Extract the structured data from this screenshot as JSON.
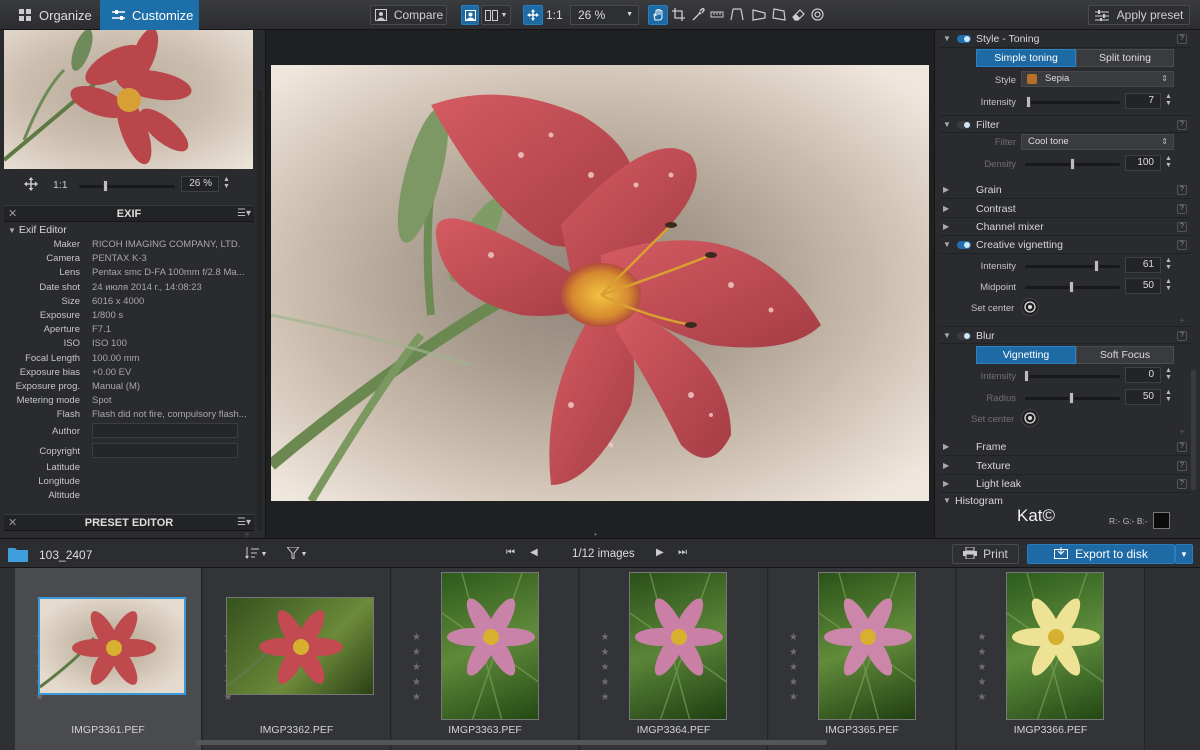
{
  "toolbar": {
    "organize_label": "Organize",
    "customize_label": "Customize",
    "compare_label": "Compare",
    "zoom_1to1": "1:1",
    "zoom_value": "26 %",
    "apply_preset_label": "Apply preset"
  },
  "navigator": {
    "zoom_1to1": "1:1",
    "zoom_value": "26 %"
  },
  "exif_panel": {
    "title": "EXIF",
    "section_label": "Exif Editor",
    "rows": [
      {
        "k": "Maker",
        "v": "RICOH IMAGING COMPANY, LTD."
      },
      {
        "k": "Camera",
        "v": "PENTAX K-3"
      },
      {
        "k": "Lens",
        "v": "Pentax smc D-FA 100mm f/2.8 Ma..."
      },
      {
        "k": "Date shot",
        "v": "24 июля 2014 г., 14:08:23"
      },
      {
        "k": "Size",
        "v": "6016 x 4000"
      },
      {
        "k": "Exposure",
        "v": "1/800 s"
      },
      {
        "k": "Aperture",
        "v": "F7.1"
      },
      {
        "k": "ISO",
        "v": "ISO 100"
      },
      {
        "k": "Focal Length",
        "v": "100.00 mm"
      },
      {
        "k": "Exposure bias",
        "v": "+0.00 EV"
      },
      {
        "k": "Exposure prog.",
        "v": "Manual (M)"
      },
      {
        "k": "Metering mode",
        "v": "Spot"
      },
      {
        "k": "Flash",
        "v": "Flash did not fire, compulsory flash..."
      }
    ],
    "editable_rows": [
      "Author",
      "Copyright"
    ],
    "gps_rows": [
      "Latitude",
      "Longitude",
      "Altitude"
    ]
  },
  "preset_editor": {
    "title": "PRESET EDITOR"
  },
  "right_panel": {
    "style_toning": {
      "title": "Style - Toning",
      "tabs": [
        "Simple toning",
        "Split toning"
      ],
      "style_label": "Style",
      "style_value": "Sepia",
      "intensity_label": "Intensity",
      "intensity_value": "7"
    },
    "filter": {
      "title": "Filter",
      "filter_label": "Filter",
      "filter_value": "Cool tone",
      "density_label": "Density",
      "density_value": "100"
    },
    "collapsed_1": [
      "Grain",
      "Contrast",
      "Channel mixer"
    ],
    "creative_vignetting": {
      "title": "Creative vignetting",
      "intensity_label": "Intensity",
      "intensity_value": "61",
      "midpoint_label": "Midpoint",
      "midpoint_value": "50",
      "set_center_label": "Set center"
    },
    "blur": {
      "title": "Blur",
      "tabs": [
        "Vignetting",
        "Soft Focus"
      ],
      "intensity_label": "Intensity",
      "intensity_value": "0",
      "radius_label": "Radius",
      "radius_value": "50",
      "set_center_label": "Set center"
    },
    "collapsed_2": [
      "Frame",
      "Texture",
      "Light leak"
    ],
    "histogram": {
      "title": "Histogram",
      "watermark": "Kat©",
      "rgb_readout": "R:- G:- B:-"
    }
  },
  "bottom_bar": {
    "folder_name": "103_2407",
    "image_count": "1/12 images",
    "print_label": "Print",
    "export_label": "Export to disk"
  },
  "filmstrip": {
    "files": [
      "IMGP3361.PEF",
      "IMGP3362.PEF",
      "IMGP3363.PEF",
      "IMGP3364.PEF",
      "IMGP3365.PEF",
      "IMGP3366.PEF"
    ]
  },
  "colors": {
    "accent": "#1d6aa5",
    "panel": "#2a2b2e",
    "sepia_swatch": "#b86f2c"
  }
}
